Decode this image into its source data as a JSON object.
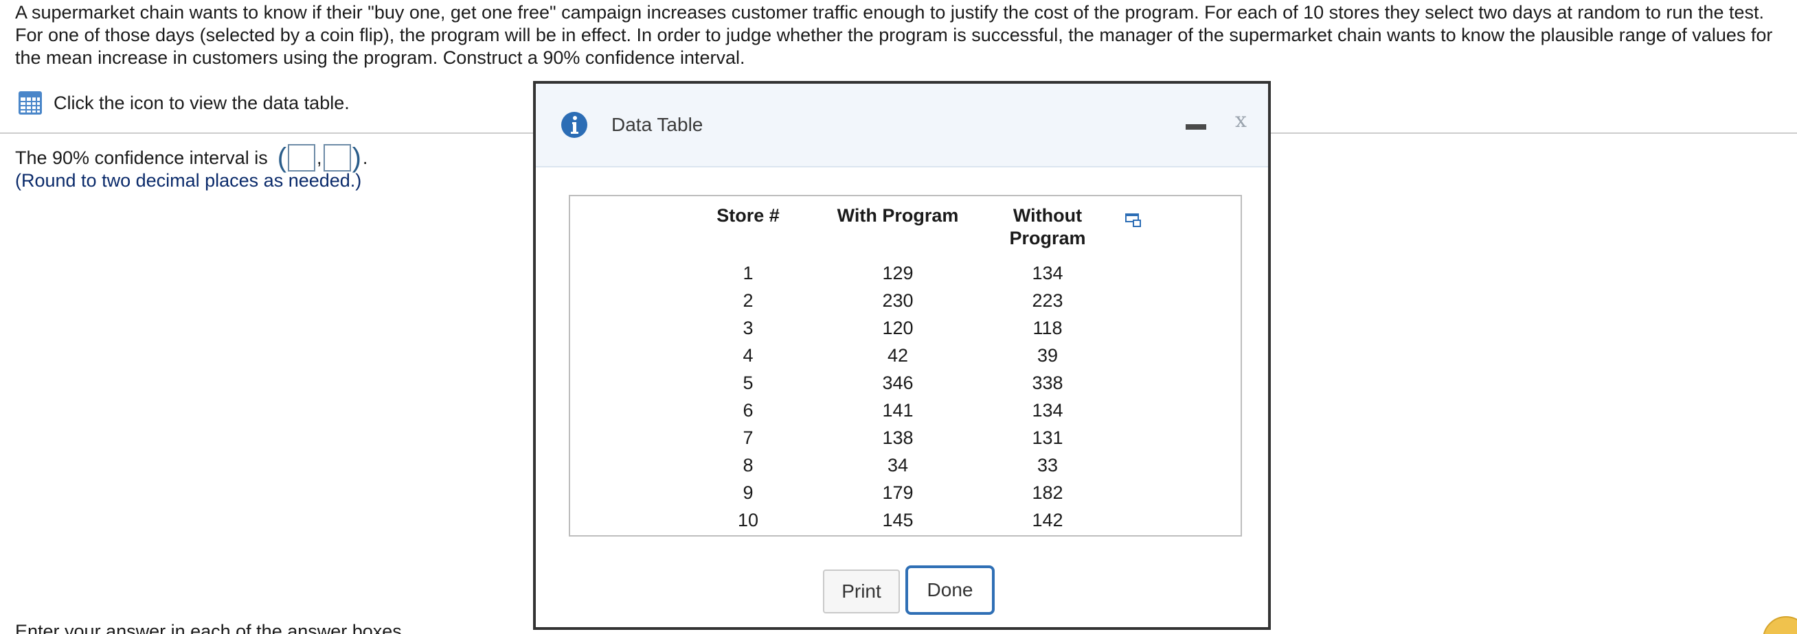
{
  "question": {
    "text": "A supermarket chain wants to know if their \"buy one, get one free\" campaign increases customer traffic enough to justify the cost of the program. For each of 10 stores they select two days at random to run the test. For one of those days (selected by a coin flip), the program will be in effect. In order to judge whether the program is successful, the manager of the supermarket chain wants to know the plausible range of values for the mean increase in customers using the program. Construct a 90% confidence interval."
  },
  "data_link": {
    "icon": "grid-table-icon",
    "text": "Click the icon to view the data table."
  },
  "answer": {
    "prefix": "The 90% confidence interval is",
    "lower_value": "",
    "upper_value": "",
    "comma": ",",
    "suffix": ".",
    "hint": "(Round to two decimal places as needed.)"
  },
  "cutoff_text": "Enter your answer in each of the answer boxes.",
  "modal": {
    "title": "Data Table",
    "info_icon": "info-icon",
    "minimize_icon": "minimize-icon",
    "close_icon": "close-icon",
    "close_glyph": "x",
    "columns": [
      "Store #",
      "With Program",
      "Without Program"
    ],
    "rows": [
      [
        "1",
        "129",
        "134"
      ],
      [
        "2",
        "230",
        "223"
      ],
      [
        "3",
        "120",
        "118"
      ],
      [
        "4",
        "42",
        "39"
      ],
      [
        "5",
        "346",
        "338"
      ],
      [
        "6",
        "141",
        "134"
      ],
      [
        "7",
        "138",
        "131"
      ],
      [
        "8",
        "34",
        "33"
      ],
      [
        "9",
        "179",
        "182"
      ],
      [
        "10",
        "145",
        "142"
      ]
    ],
    "copy_icon": "copy-to-clipboard-icon",
    "print_label": "Print",
    "done_label": "Done"
  },
  "colors": {
    "accent_blue": "#2f6fb5",
    "hint_text": "#0a2a6a",
    "modal_header_bg": "#f2f6fb"
  }
}
